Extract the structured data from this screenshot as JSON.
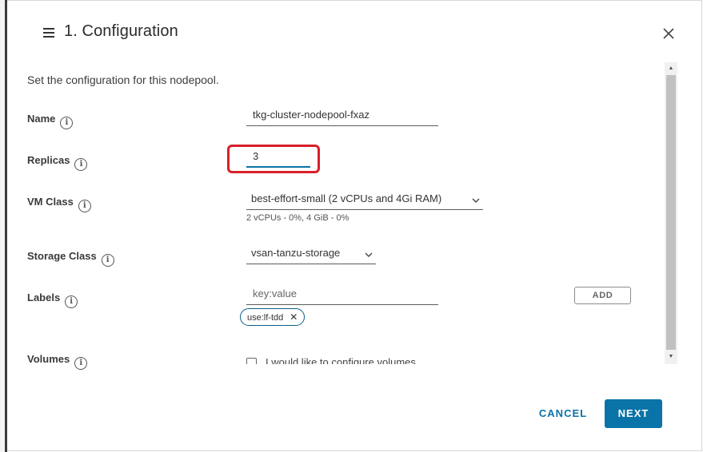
{
  "dialog": {
    "title": "1. Configuration",
    "description": "Set the configuration for this nodepool."
  },
  "fields": {
    "name": {
      "label": "Name",
      "value": "tkg-cluster-nodepool-fxaz"
    },
    "replicas": {
      "label": "Replicas",
      "value": "3"
    },
    "vm_class": {
      "label": "VM Class",
      "value": "best-effort-small (2 vCPUs and 4Gi RAM)",
      "hint": "2 vCPUs - 0%, 4 GiB - 0%"
    },
    "storage_class": {
      "label": "Storage Class",
      "value": "vsan-tanzu-storage"
    },
    "labels": {
      "label": "Labels",
      "placeholder": "key:value",
      "add_label": "ADD",
      "chips": [
        "use:lf-tdd"
      ]
    },
    "volumes": {
      "label": "Volumes",
      "checkbox_label": "I would like to configure volumes"
    }
  },
  "footer": {
    "cancel_label": "CANCEL",
    "next_label": "NEXT"
  },
  "colors": {
    "primary": "#0a73a8",
    "highlight": "#d8202a"
  },
  "icons": {
    "menu": "menu-icon",
    "close": "close-icon",
    "info": "info-icon",
    "chevron": "chevron-down-icon",
    "chip_remove": "close-icon"
  }
}
